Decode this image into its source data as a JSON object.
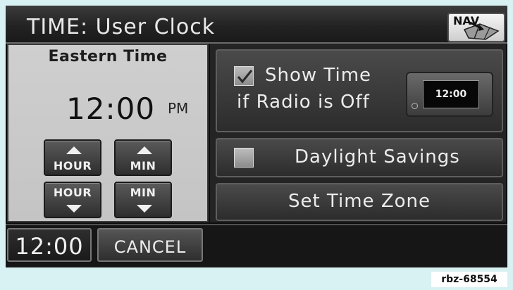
{
  "header": {
    "title": "TIME: User Clock",
    "nav_label": "NAV"
  },
  "clock_panel": {
    "zone_label": "Eastern Time",
    "time": "12:00",
    "ampm": "PM",
    "hour_up_label": "HOUR",
    "min_up_label": "MIN",
    "hour_down_label": "HOUR",
    "min_down_label": "MIN"
  },
  "options": {
    "show_time_line1": "Show Time",
    "show_time_line2": "if Radio is Off",
    "show_time_checked": true,
    "preview_time": "12:00",
    "daylight_savings_label": "Daylight Savings",
    "daylight_savings_checked": false,
    "set_time_zone_label": "Set Time Zone"
  },
  "footer": {
    "time_readout": "12:00",
    "cancel_label": "CANCEL"
  },
  "reference_code": "rbz-68554"
}
